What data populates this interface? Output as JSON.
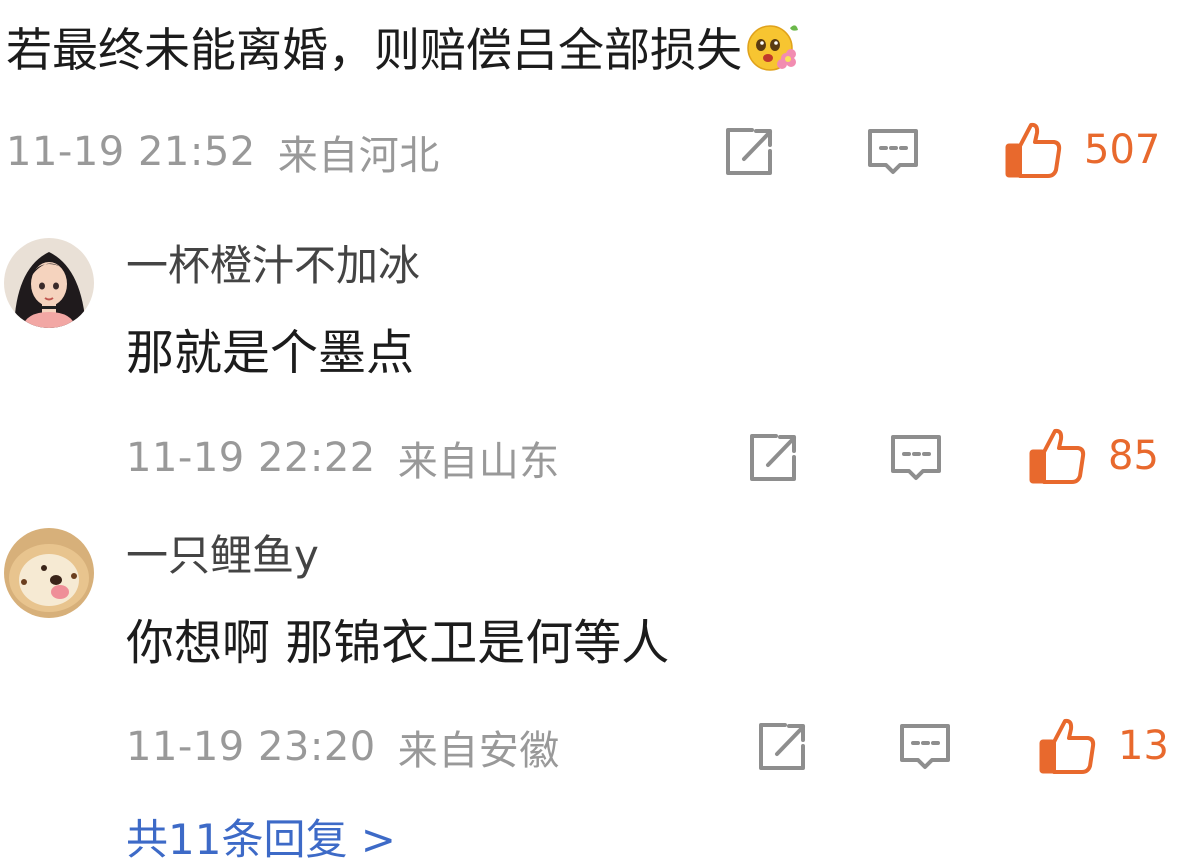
{
  "main_comment": {
    "text": "若最终未能离婚，则赔偿吕全部损失",
    "emoji": "flower-face-emoji",
    "time": "11-19 21:52",
    "location": "来自河北",
    "likes": "507"
  },
  "replies": [
    {
      "username": "一杯橙汁不加冰",
      "text": "那就是个墨点",
      "time": "11-19 22:22",
      "location": "来自山东",
      "likes": "85",
      "avatar": "avatar-girl-illustration"
    },
    {
      "username": "一只鲤鱼y",
      "text": "你想啊 那锦衣卫是何等人",
      "time": "11-19 23:20",
      "location": "来自安徽",
      "likes": "13",
      "avatar": "avatar-dog-bread"
    }
  ],
  "more_replies": "共11条回复 >",
  "icons": {
    "share": "share-icon",
    "comment": "comment-icon",
    "like": "thumbs-up-icon"
  },
  "colors": {
    "like_accent": "#e8692d",
    "meta_gray": "#999999",
    "icon_gray": "#8e8e8e",
    "link_blue": "#3d6ac7"
  }
}
